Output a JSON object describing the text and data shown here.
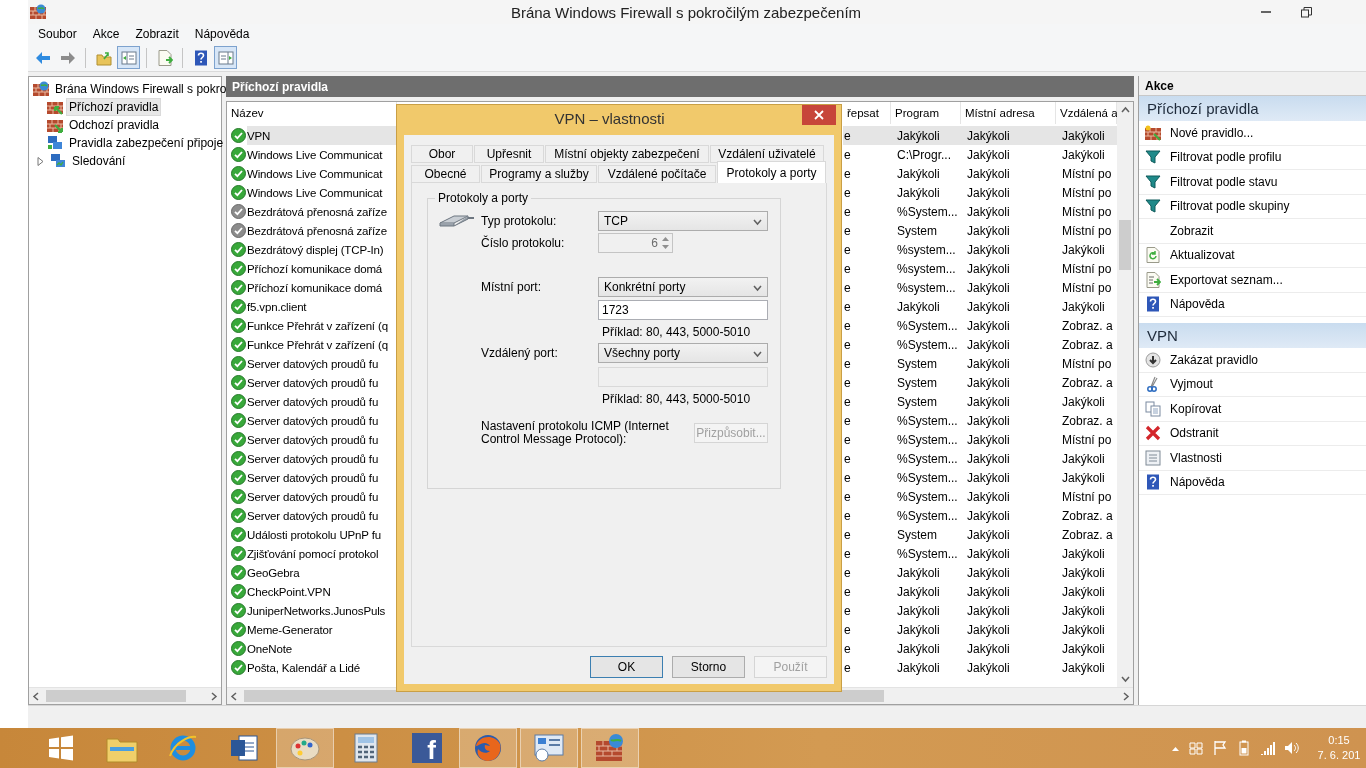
{
  "window": {
    "title": "Brána Windows Firewall s pokročilým zabezpečením"
  },
  "menu": [
    "Soubor",
    "Akce",
    "Zobrazit",
    "Nápověda"
  ],
  "toolbar": [
    [
      {
        "kind": "back",
        "pressed": false
      },
      {
        "kind": "forward",
        "pressed": false
      }
    ],
    [
      {
        "kind": "up",
        "pressed": false
      },
      {
        "kind": "tree",
        "pressed": true
      }
    ],
    [
      {
        "kind": "export",
        "pressed": false
      }
    ],
    [
      {
        "kind": "help",
        "pressed": false
      },
      {
        "kind": "actions",
        "pressed": true
      }
    ]
  ],
  "tree": {
    "label": "Brána Windows Firewall s pokro",
    "children": [
      {
        "label": "Příchozí pravidla",
        "kind": "inbound",
        "selected": true
      },
      {
        "label": "Odchozí pravidla",
        "kind": "outbound",
        "selected": false
      },
      {
        "label": "Pravidla zabezpečení připoje",
        "kind": "security",
        "selected": false
      },
      {
        "label": "Sledování",
        "kind": "monitor",
        "selected": false,
        "expanded": false
      }
    ]
  },
  "center": {
    "title": "Příchozí pravidla",
    "columns": [
      "Název",
      "řepsat",
      "Program",
      "Místní adresa",
      "Vzdálená a"
    ],
    "rows": [
      {
        "name": "VPN",
        "enabled": true,
        "selected": true,
        "override": "e",
        "program": "Jakýkoli",
        "local": "Jakýkoli",
        "remote": "Jakýkoli"
      },
      {
        "name": "Windows Live Communicat",
        "enabled": true,
        "selected": false,
        "override": "e",
        "program": "C:\\Progr...",
        "local": "Jakýkoli",
        "remote": "Jakýkoli"
      },
      {
        "name": "Windows Live Communicat",
        "enabled": true,
        "selected": false,
        "override": "e",
        "program": "Jakýkoli",
        "local": "Jakýkoli",
        "remote": "Místní po"
      },
      {
        "name": "Windows Live Communicat",
        "enabled": true,
        "selected": false,
        "override": "e",
        "program": "Jakýkoli",
        "local": "Jakýkoli",
        "remote": "Místní po"
      },
      {
        "name": "Bezdrátová přenosná zaříze",
        "enabled": false,
        "selected": false,
        "override": "e",
        "program": "%System...",
        "local": "Jakýkoli",
        "remote": "Místní po"
      },
      {
        "name": "Bezdrátová přenosná zaříze",
        "enabled": false,
        "selected": false,
        "override": "e",
        "program": "System",
        "local": "Jakýkoli",
        "remote": "Místní po"
      },
      {
        "name": "Bezdrátový displej (TCP-In)",
        "enabled": true,
        "selected": false,
        "override": "e",
        "program": "%system...",
        "local": "Jakýkoli",
        "remote": "Jakýkoli"
      },
      {
        "name": "Příchozí komunikace domá",
        "enabled": true,
        "selected": false,
        "override": "e",
        "program": "%system...",
        "local": "Jakýkoli",
        "remote": "Místní po"
      },
      {
        "name": "Příchozí komunikace domá",
        "enabled": true,
        "selected": false,
        "override": "e",
        "program": "%system...",
        "local": "Jakýkoli",
        "remote": "Místní po"
      },
      {
        "name": "f5.vpn.client",
        "enabled": true,
        "selected": false,
        "override": "e",
        "program": "Jakýkoli",
        "local": "Jakýkoli",
        "remote": "Jakýkoli"
      },
      {
        "name": "Funkce Přehrát v zařízení (q",
        "enabled": true,
        "selected": false,
        "override": "e",
        "program": "%System...",
        "local": "Jakýkoli",
        "remote": "Zobraz. a"
      },
      {
        "name": "Funkce Přehrát v zařízení (q",
        "enabled": true,
        "selected": false,
        "override": "e",
        "program": "%System...",
        "local": "Jakýkoli",
        "remote": "Zobraz. a"
      },
      {
        "name": "Server datových proudů fu",
        "enabled": true,
        "selected": false,
        "override": "e",
        "program": "System",
        "local": "Jakýkoli",
        "remote": "Místní po"
      },
      {
        "name": "Server datových proudů fu",
        "enabled": true,
        "selected": false,
        "override": "e",
        "program": "System",
        "local": "Jakýkoli",
        "remote": "Zobraz. a"
      },
      {
        "name": "Server datových proudů fu",
        "enabled": true,
        "selected": false,
        "override": "e",
        "program": "System",
        "local": "Jakýkoli",
        "remote": "Jakýkoli"
      },
      {
        "name": "Server datových proudů fu",
        "enabled": true,
        "selected": false,
        "override": "e",
        "program": "%System...",
        "local": "Jakýkoli",
        "remote": "Zobraz. a"
      },
      {
        "name": "Server datových proudů fu",
        "enabled": true,
        "selected": false,
        "override": "e",
        "program": "%System...",
        "local": "Jakýkoli",
        "remote": "Místní po"
      },
      {
        "name": "Server datových proudů fu",
        "enabled": true,
        "selected": false,
        "override": "e",
        "program": "%System...",
        "local": "Jakýkoli",
        "remote": "Jakýkoli"
      },
      {
        "name": "Server datových proudů fu",
        "enabled": true,
        "selected": false,
        "override": "e",
        "program": "%System...",
        "local": "Jakýkoli",
        "remote": "Jakýkoli"
      },
      {
        "name": "Server datových proudů fu",
        "enabled": true,
        "selected": false,
        "override": "e",
        "program": "%System...",
        "local": "Jakýkoli",
        "remote": "Místní po"
      },
      {
        "name": "Server datových proudů fu",
        "enabled": true,
        "selected": false,
        "override": "e",
        "program": "%System...",
        "local": "Jakýkoli",
        "remote": "Zobraz. a"
      },
      {
        "name": "Události protokolu UPnP fu",
        "enabled": true,
        "selected": false,
        "override": "e",
        "program": "System",
        "local": "Jakýkoli",
        "remote": "Zobraz. a"
      },
      {
        "name": "Zjišťování pomocí protokol",
        "enabled": true,
        "selected": false,
        "override": "e",
        "program": "%System...",
        "local": "Jakýkoli",
        "remote": "Jakýkoli"
      },
      {
        "name": "GeoGebra",
        "enabled": true,
        "selected": false,
        "override": "e",
        "program": "Jakýkoli",
        "local": "Jakýkoli",
        "remote": "Jakýkoli"
      },
      {
        "name": "CheckPoint.VPN",
        "enabled": true,
        "selected": false,
        "override": "e",
        "program": "Jakýkoli",
        "local": "Jakýkoli",
        "remote": "Jakýkoli"
      },
      {
        "name": "JuniperNetworks.JunosPuls",
        "enabled": true,
        "selected": false,
        "override": "e",
        "program": "Jakýkoli",
        "local": "Jakýkoli",
        "remote": "Jakýkoli"
      },
      {
        "name": "Meme-Generator",
        "enabled": true,
        "selected": false,
        "override": "e",
        "program": "Jakýkoli",
        "local": "Jakýkoli",
        "remote": "Jakýkoli"
      },
      {
        "name": "OneNote",
        "enabled": true,
        "selected": false,
        "override": "e",
        "program": "Jakýkoli",
        "local": "Jakýkoli",
        "remote": "Jakýkoli"
      },
      {
        "name": "Pošta, Kalendář a Lidé",
        "enabled": true,
        "selected": false,
        "override": "e",
        "program": "Jakýkoli",
        "local": "Jakýkoli",
        "remote": "Jakýkoli"
      }
    ]
  },
  "actions": {
    "title": "Akce",
    "sections": [
      {
        "title": "Příchozí pravidla",
        "items": [
          {
            "label": "Nové pravidlo...",
            "kind": "new-rule"
          },
          {
            "label": "Filtrovat podle profilu",
            "kind": "filter"
          },
          {
            "label": "Filtrovat podle stavu",
            "kind": "filter"
          },
          {
            "label": "Filtrovat podle skupiny",
            "kind": "filter"
          },
          {
            "label": "Zobrazit",
            "kind": "view"
          },
          {
            "label": "Aktualizovat",
            "kind": "refresh"
          },
          {
            "label": "Exportovat seznam...",
            "kind": "export"
          },
          {
            "label": "Nápověda",
            "kind": "help"
          }
        ]
      },
      {
        "title": "VPN",
        "items": [
          {
            "label": "Zakázat pravidlo",
            "kind": "disable"
          },
          {
            "label": "Vyjmout",
            "kind": "cut"
          },
          {
            "label": "Kopírovat",
            "kind": "copy"
          },
          {
            "label": "Odstranit",
            "kind": "delete"
          },
          {
            "label": "Vlastnosti",
            "kind": "properties"
          },
          {
            "label": "Nápověda",
            "kind": "help"
          }
        ]
      }
    ]
  },
  "dialog": {
    "title": "VPN – vlastnosti",
    "tab_rows": [
      [
        {
          "label": "Obor",
          "selected": false
        },
        {
          "label": "Upřesnit",
          "selected": false
        },
        {
          "label": "Místní objekty zabezpečení",
          "selected": false
        },
        {
          "label": "Vzdálení uživatelé",
          "selected": false
        }
      ],
      [
        {
          "label": "Obecné",
          "selected": false
        },
        {
          "label": "Programy a služby",
          "selected": false
        },
        {
          "label": "Vzdálené počítače",
          "selected": false
        },
        {
          "label": "Protokoly a porty",
          "selected": true
        }
      ]
    ],
    "group": {
      "title": "Protokoly a porty",
      "protocol_type": {
        "label": "Typ protokolu:",
        "value": "TCP"
      },
      "protocol_number": {
        "label": "Číslo protokolu:",
        "value": "6",
        "disabled": true
      },
      "local_port": {
        "label": "Místní port:",
        "value": "Konkrétní porty",
        "ports": "1723",
        "ports_disabled": false,
        "example": "Příklad: 80, 443, 5000-5010"
      },
      "remote_port": {
        "label": "Vzdálený port:",
        "value": "Všechny porty",
        "ports_disabled": true,
        "example": "Příklad: 80, 443, 5000-5010"
      },
      "icmp": {
        "label": "Nastavení protokolu ICMP (Internet Control Message Protocol):",
        "button": "Přizpůsobit...",
        "disabled": true
      }
    },
    "buttons": [
      {
        "label": "OK",
        "default": true,
        "disabled": false
      },
      {
        "label": "Storno",
        "default": false,
        "disabled": false
      },
      {
        "label": "Použít",
        "default": false,
        "disabled": true
      }
    ]
  },
  "taskbar": {
    "apps": [
      {
        "kind": "explorer",
        "running": false
      },
      {
        "kind": "browser",
        "running": false
      },
      {
        "kind": "word",
        "running": false
      },
      {
        "kind": "paint",
        "running": true
      },
      {
        "kind": "calculator",
        "running": false
      },
      {
        "kind": "social",
        "running": false,
        "glyph": "f"
      },
      {
        "kind": "firefox",
        "running": true
      },
      {
        "kind": "control-panel",
        "running": true
      },
      {
        "kind": "firewall",
        "running": true
      }
    ],
    "time": "0:15",
    "date": "7. 6. 201"
  }
}
